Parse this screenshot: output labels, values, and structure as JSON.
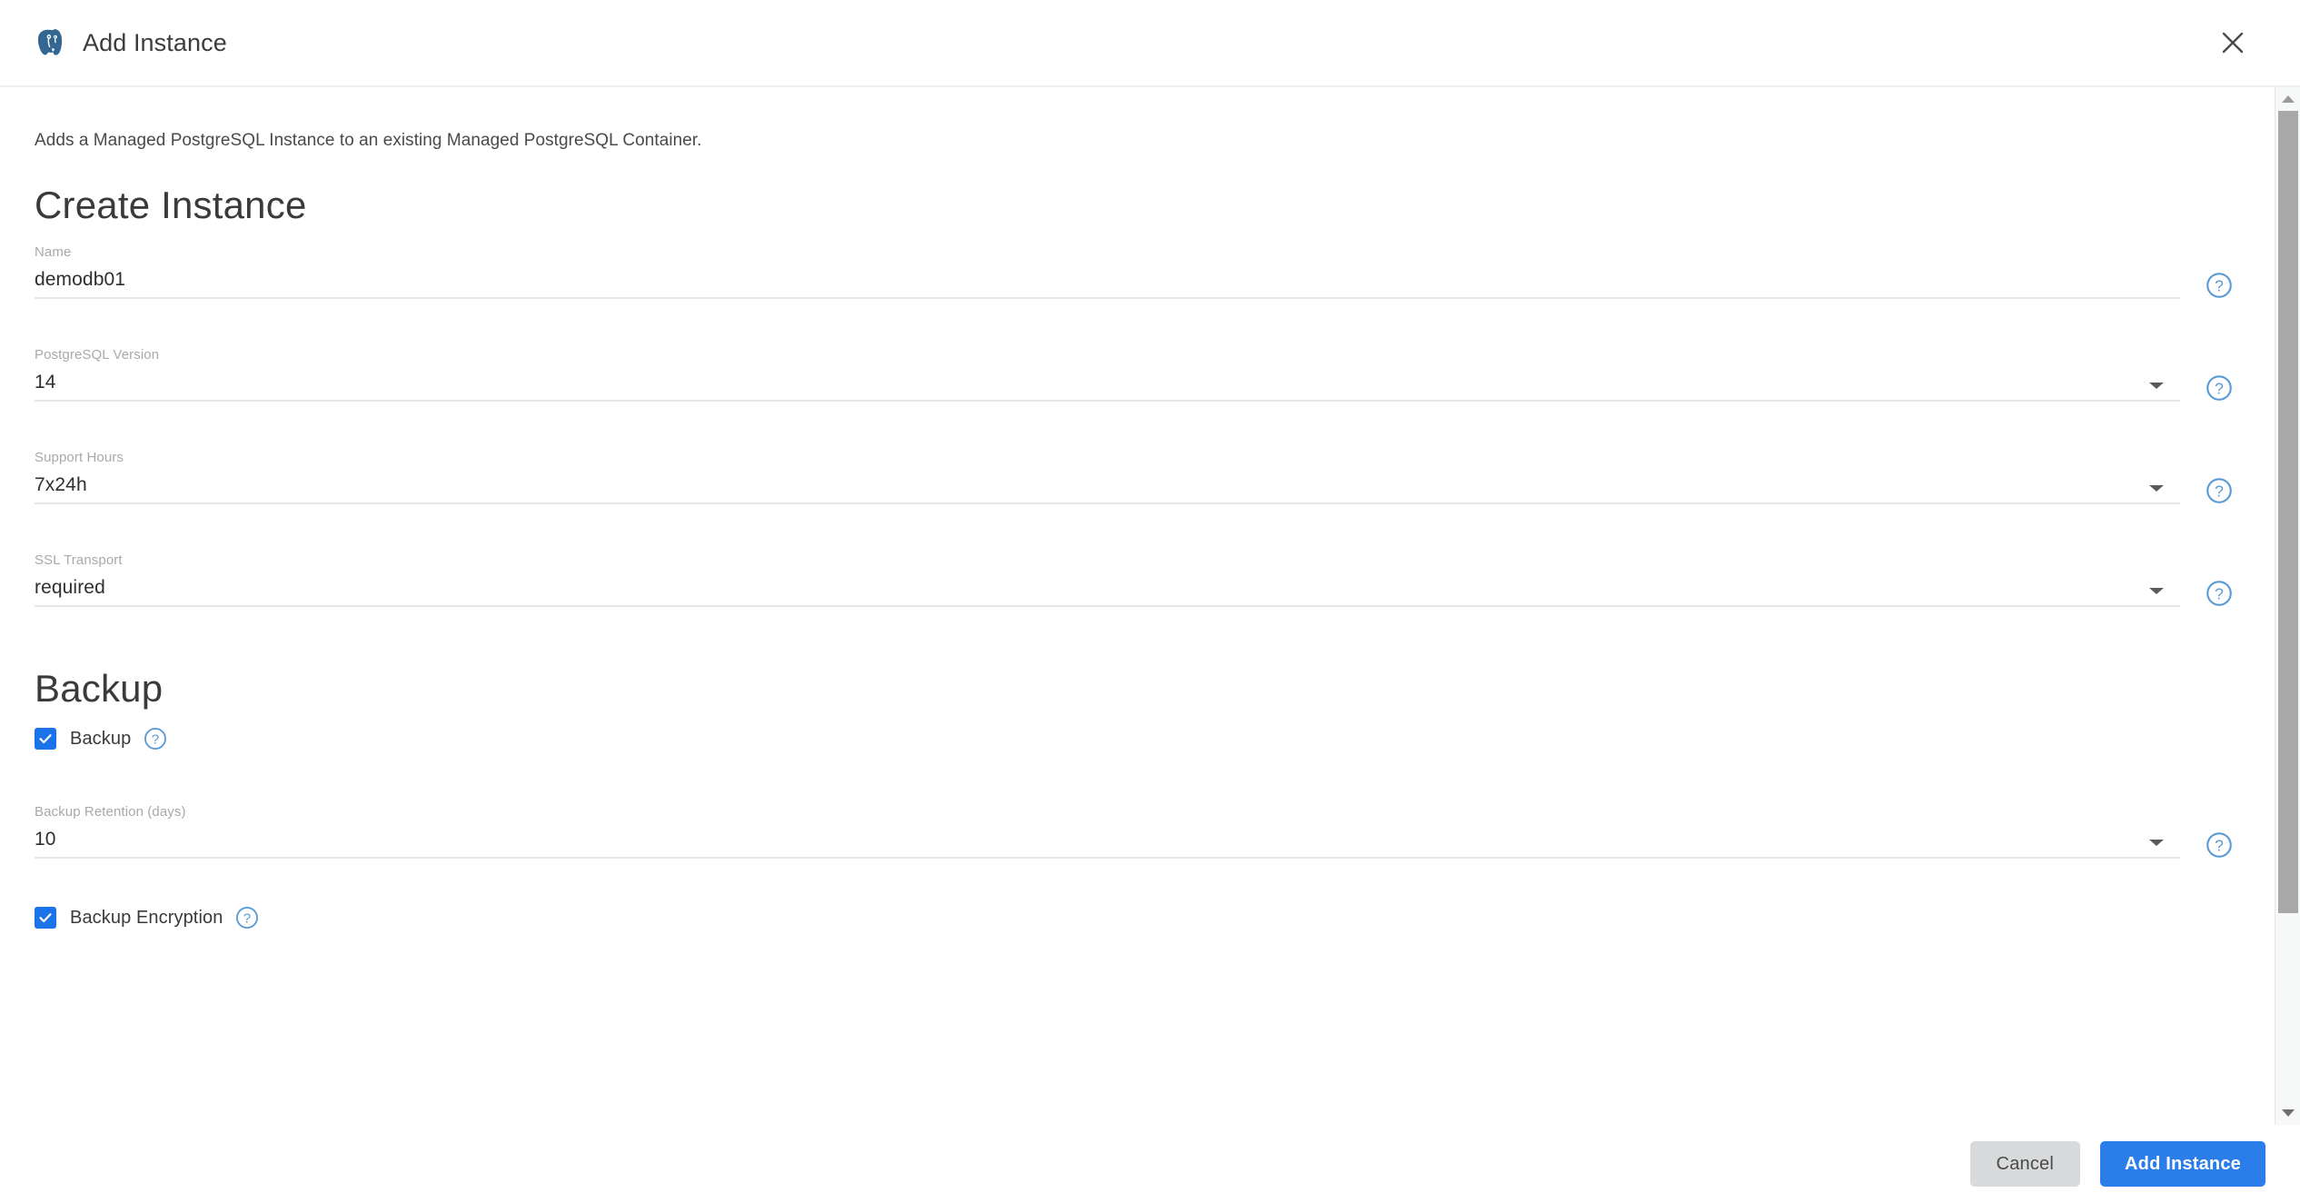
{
  "window": {
    "title": "Add Instance",
    "logo_icon": "postgresql-elephant-icon",
    "close_icon": "close-icon"
  },
  "content": {
    "intro": "Adds a Managed PostgreSQL Instance to an existing Managed PostgreSQL Container.",
    "sections": [
      {
        "heading": "Create Instance",
        "fields": [
          {
            "label": "Name",
            "value": "demodb01",
            "type": "text",
            "help_icon": "help-circle-icon"
          },
          {
            "label": "PostgreSQL Version",
            "value": "14",
            "type": "select",
            "caret_icon": "chevron-down-icon",
            "help_icon": "help-circle-icon"
          },
          {
            "label": "Support Hours",
            "value": "7x24h",
            "type": "select",
            "caret_icon": "chevron-down-icon",
            "help_icon": "help-circle-icon"
          },
          {
            "label": "SSL Transport",
            "value": "required",
            "type": "select",
            "caret_icon": "chevron-down-icon",
            "help_icon": "help-circle-icon"
          }
        ]
      },
      {
        "heading": "Backup",
        "checkbox_backup": {
          "label": "Backup",
          "checked": true,
          "help_icon": "help-circle-icon"
        },
        "field_retention": {
          "label": "Backup Retention (days)",
          "value": "10",
          "type": "select",
          "caret_icon": "chevron-down-icon",
          "help_icon": "help-circle-icon"
        },
        "checkbox_encryption": {
          "label": "Backup Encryption",
          "checked": true,
          "help_icon": "help-circle-icon"
        }
      }
    ]
  },
  "scrollbar": {
    "up_icon": "scroll-up-arrow-icon",
    "down_icon": "scroll-down-arrow-icon"
  },
  "footer": {
    "cancel_label": "Cancel",
    "submit_label": "Add Instance"
  },
  "colors": {
    "primary_button": "#2b7de9",
    "checkbox": "#1a73e8",
    "help_icon": "#5b9bd5",
    "postgres_logo": "#336791",
    "field_underline": "#e4e8ea"
  }
}
